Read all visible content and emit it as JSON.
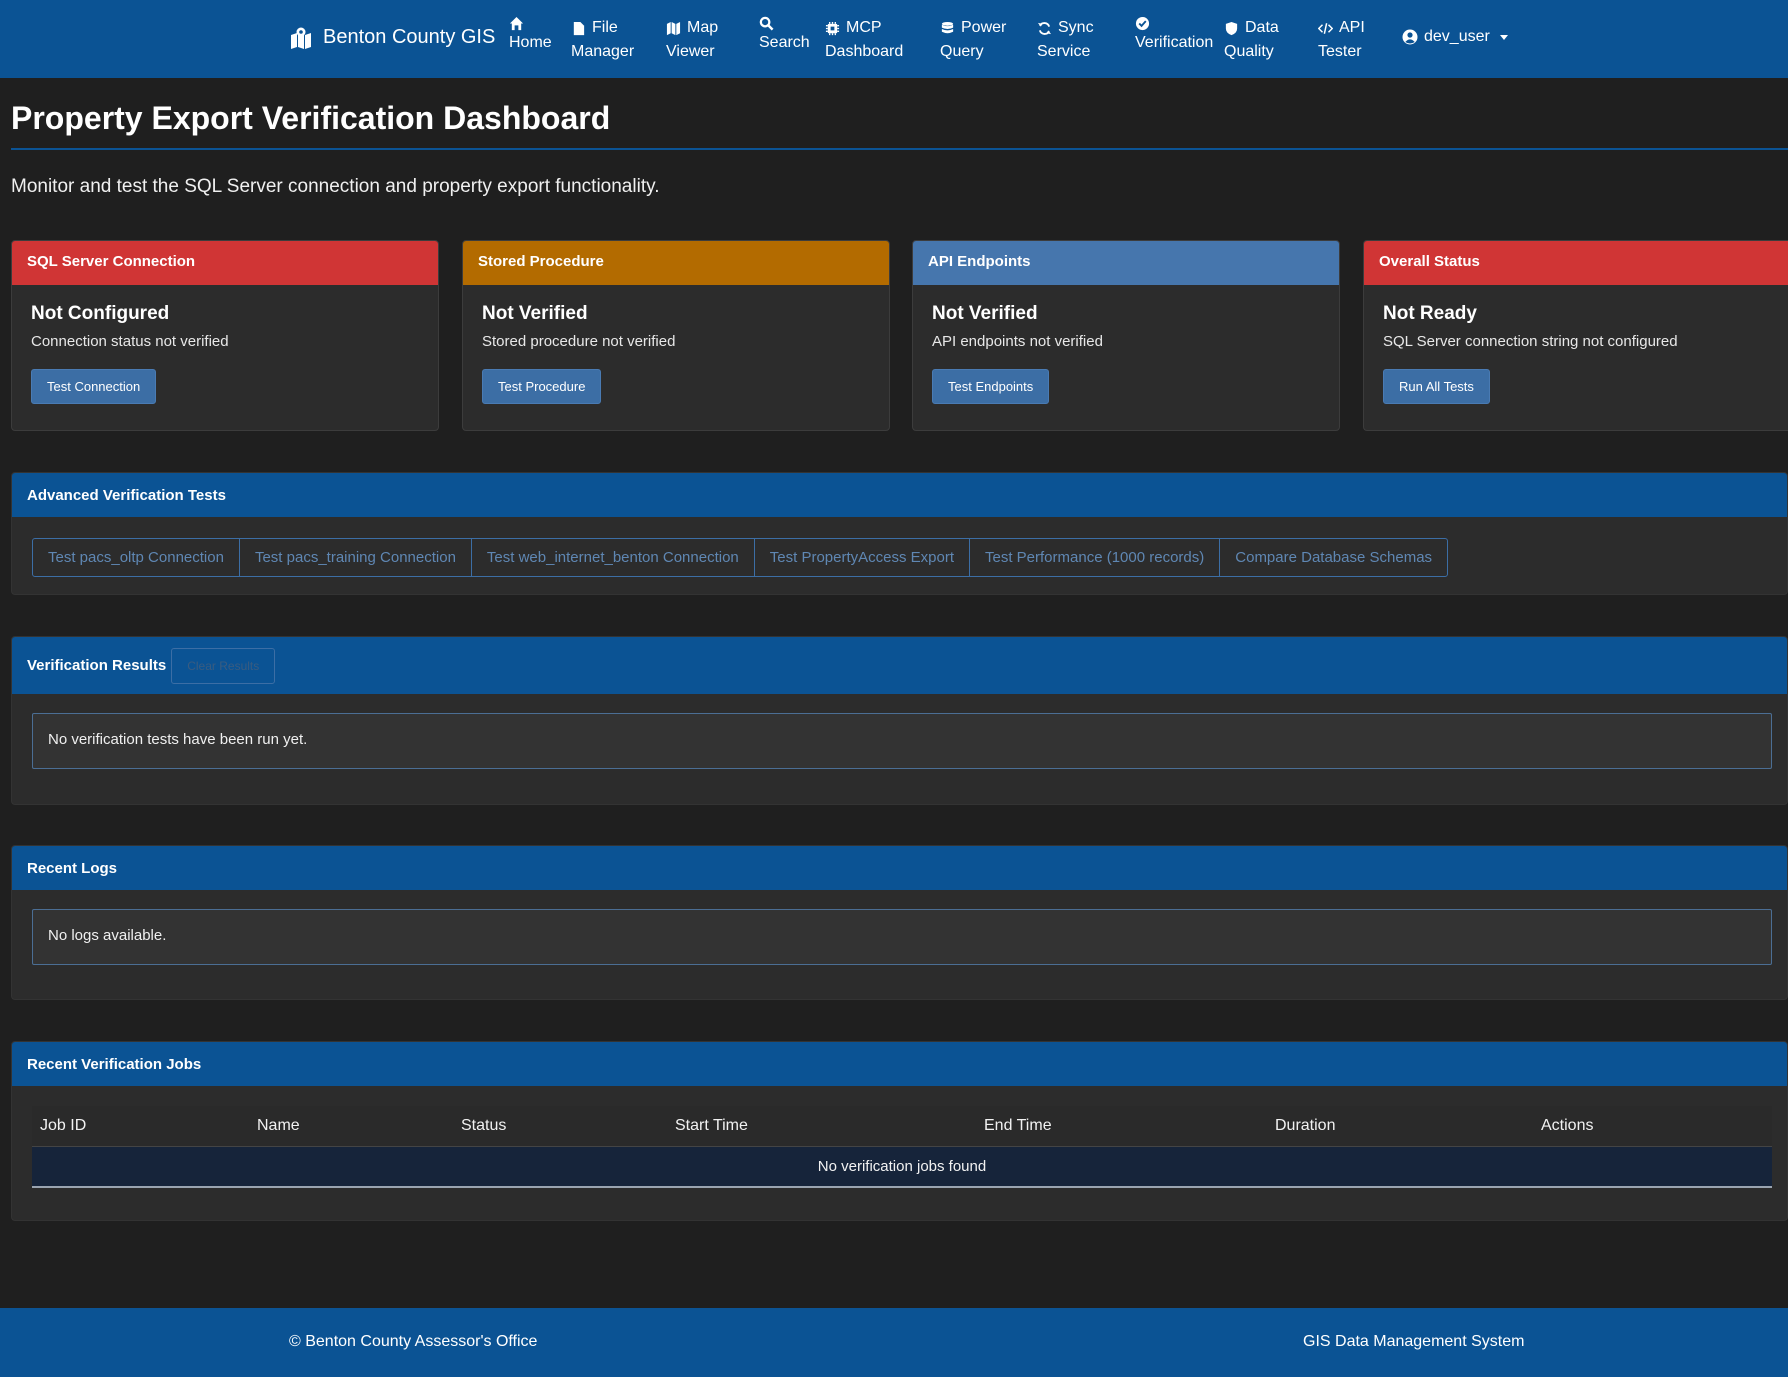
{
  "nav": {
    "brand": "Benton County GIS",
    "items": [
      {
        "l1": "",
        "l2": "Home",
        "icon": "home-icon"
      },
      {
        "l1": "File",
        "l2": "Manager",
        "icon": "file-icon"
      },
      {
        "l1": "Map",
        "l2": "Viewer",
        "icon": "map-icon"
      },
      {
        "l1": "",
        "l2": "Search",
        "icon": "search-icon"
      },
      {
        "l1": "MCP",
        "l2": "Dashboard",
        "icon": "chip-icon"
      },
      {
        "l1": "Power",
        "l2": "Query",
        "icon": "database-icon"
      },
      {
        "l1": "Sync",
        "l2": "Service",
        "icon": "sync-icon"
      },
      {
        "l1": "",
        "l2": "Verification",
        "icon": "check-circle-icon"
      },
      {
        "l1": "Data",
        "l2": "Quality",
        "icon": "shield-icon"
      },
      {
        "l1": "API",
        "l2": "Tester",
        "icon": "code-icon"
      }
    ],
    "user": "dev_user"
  },
  "page": {
    "title": "Property Export Verification Dashboard",
    "lead": "Monitor and test the SQL Server connection and property export functionality."
  },
  "cards": [
    {
      "header": "SQL Server Connection",
      "status": "Not Configured",
      "text": "Connection status not verified",
      "button": "Test Connection",
      "color": "#d03535"
    },
    {
      "header": "Stored Procedure",
      "status": "Not Verified",
      "text": "Stored procedure not verified",
      "button": "Test Procedure",
      "color": "#b36b00"
    },
    {
      "header": "API Endpoints",
      "status": "Not Verified",
      "text": "API endpoints not verified",
      "button": "Test Endpoints",
      "color": "#4676ad"
    },
    {
      "header": "Overall Status",
      "status": "Not Ready",
      "text": "SQL Server connection string not configured",
      "button": "Run All Tests",
      "color": "#d03535"
    }
  ],
  "advanced": {
    "header": "Advanced Verification Tests",
    "buttons": [
      "Test pacs_oltp Connection",
      "Test pacs_training Connection",
      "Test web_internet_benton Connection",
      "Test PropertyAccess Export",
      "Test Performance (1000 records)",
      "Compare Database Schemas"
    ]
  },
  "results": {
    "header": "Verification Results",
    "clear_label": "Clear Results",
    "message": "No verification tests have been run yet."
  },
  "logs": {
    "header": "Recent Logs",
    "message": "No logs available."
  },
  "jobs": {
    "header": "Recent Verification Jobs",
    "columns": [
      "Job ID",
      "Name",
      "Status",
      "Start Time",
      "End Time",
      "Duration",
      "Actions"
    ],
    "empty": "No verification jobs found"
  },
  "footer": {
    "left": "© Benton County Assessor's Office",
    "right": "GIS Data Management System"
  }
}
